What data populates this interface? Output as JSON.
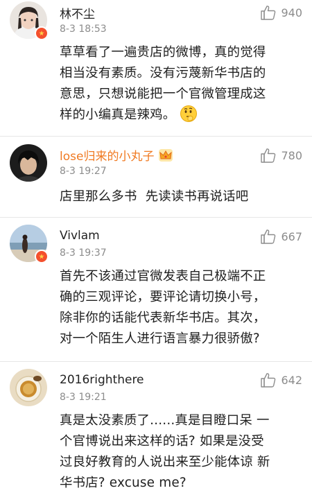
{
  "comments": [
    {
      "username": "林不尘",
      "time": "8-3 18:53",
      "likes": "940",
      "verified": true,
      "lines": [
        "草草看了一遍贵店的微博，真的觉得",
        "相当没有素质。没有污蔑新华书店的",
        "意思，只想说能把一个官微管理成这",
        "样的小编真是辣鸡。"
      ],
      "emoji": "thinking-face"
    },
    {
      "username": "lose归来的小丸子",
      "username_color": "#f07a22",
      "badge": "crown-icon",
      "time": "8-3 19:27",
      "likes": "780",
      "verified": false,
      "lines": [
        "店里那么多书  先读读书再说话吧"
      ]
    },
    {
      "username": "Vivlam",
      "time": "8-3 19:37",
      "likes": "667",
      "verified": true,
      "lines": [
        "首先不该通过官微发表自己极端不正",
        "确的三观评论，要评论请切换小号，",
        "除非你的话能代表新华书店。其次，",
        "对一个陌生人进行语言暴力很骄傲?"
      ]
    },
    {
      "username": "2016righthere",
      "time": "8-3 19:21",
      "likes": "642",
      "verified": false,
      "lines": [
        "真是太没素质了......真是目瞪口呆 一",
        "个官博说出来这样的话? 如果是没受",
        "过良好教育的人说出来至少能体谅 新",
        "华书店? excuse me?"
      ]
    }
  ],
  "colors": {
    "username_default": "#222222",
    "username_vip": "#f07a22",
    "meta": "#8c8c8c",
    "text": "#1f1f1f",
    "verified_badge": "#f4502d",
    "divider": "#e6e6e6"
  },
  "icons": {
    "like": "thumbs-up-icon",
    "verified": "verified-star-badge-icon",
    "vip": "crown-icon"
  }
}
